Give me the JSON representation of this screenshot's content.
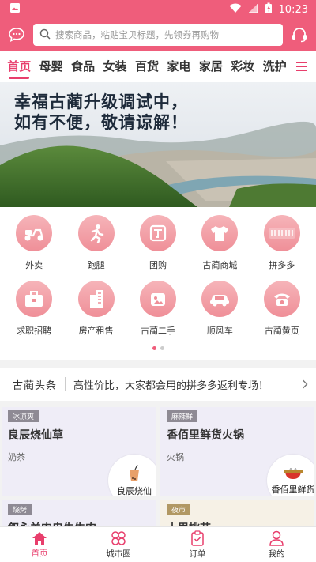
{
  "status_bar": {
    "time": "10:23"
  },
  "search": {
    "placeholder": "搜索商品，粘贴宝贝标题，先领券再购物"
  },
  "categories": [
    "首页",
    "母婴",
    "食品",
    "女装",
    "百货",
    "家电",
    "家居",
    "彩妆",
    "洗护"
  ],
  "banner": {
    "line1": "幸福古蔺升级调试中，",
    "line2": "如有不便，敬请谅解！"
  },
  "services_row1": [
    {
      "label": "外卖",
      "icon": "scooter-icon"
    },
    {
      "label": "跑腿",
      "icon": "runner-icon"
    },
    {
      "label": "团购",
      "icon": "group-buy-icon"
    },
    {
      "label": "古蔺商城",
      "icon": "tshirt-icon"
    },
    {
      "label": "拼多多",
      "icon": "pinduoduo-icon"
    }
  ],
  "services_row2": [
    {
      "label": "求职招聘",
      "icon": "briefcase-icon"
    },
    {
      "label": "房产租售",
      "icon": "building-icon"
    },
    {
      "label": "古蔺二手",
      "icon": "secondhand-icon"
    },
    {
      "label": "顺风车",
      "icon": "car-icon"
    },
    {
      "label": "古蔺黄页",
      "icon": "phone-icon"
    }
  ],
  "news": {
    "logo": "古蔺头条",
    "text": "高性价比，大家都会用的拼多多返利专场！"
  },
  "cards": [
    {
      "tag": "冰凉爽",
      "title": "良辰烧仙草",
      "sub": "奶茶",
      "img_text": "良辰烧仙"
    },
    {
      "tag": "麻辣鲜",
      "title": "香佰里鲜货火锅",
      "sub": "火锅",
      "img_text": "香佰里鲜货"
    },
    {
      "tag": "烧烤",
      "title": "叙永羊肉串生牛肉",
      "sub": ""
    },
    {
      "tag": "夜市",
      "title": "十里桃花",
      "sub": ""
    }
  ],
  "tabs": [
    {
      "label": "首页",
      "icon": "home-icon"
    },
    {
      "label": "城市圈",
      "icon": "city-circle-icon"
    },
    {
      "label": "订单",
      "icon": "order-icon"
    },
    {
      "label": "我的",
      "icon": "profile-icon"
    }
  ],
  "colors": {
    "brand": "#ef5d7b",
    "active": "#e83e6c"
  }
}
